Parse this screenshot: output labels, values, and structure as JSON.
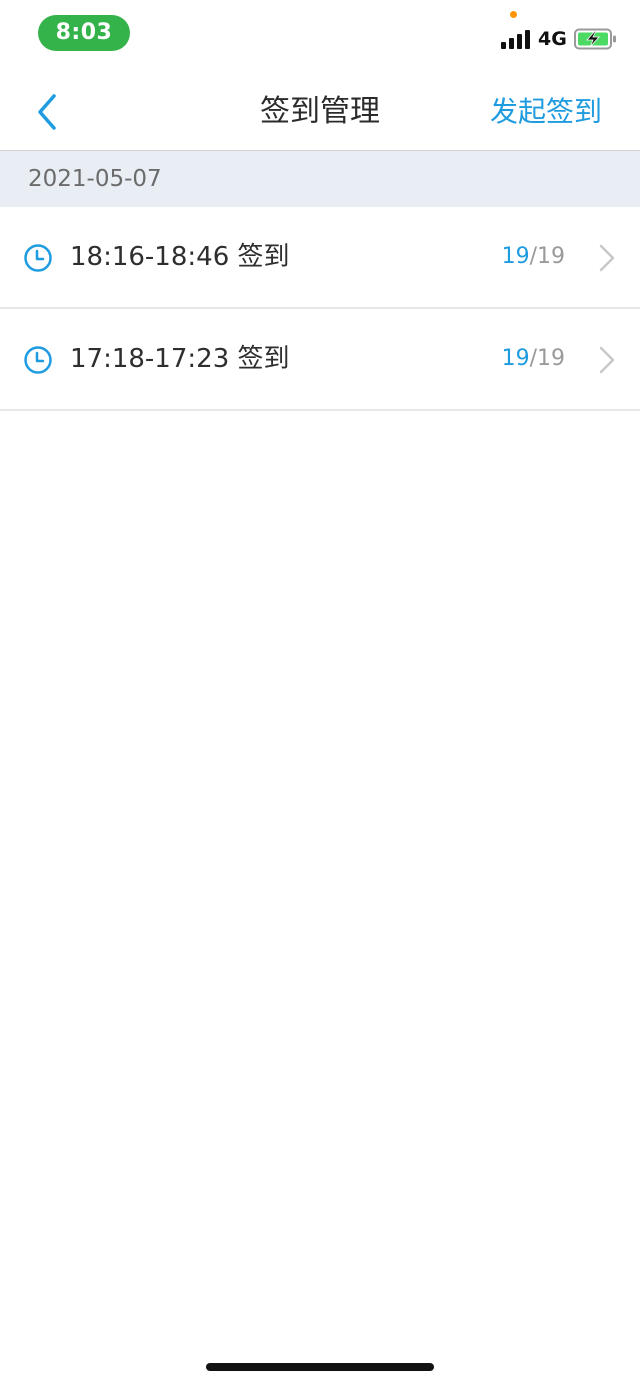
{
  "status_bar": {
    "time": "8:03",
    "network": "4G",
    "icons": [
      "signal-icon",
      "battery-charging-icon"
    ],
    "colors": {
      "time_pill": "#34b34a",
      "privacy_dot": "#ff9500",
      "battery_fill": "#4cd964"
    }
  },
  "nav": {
    "back_icon": "chevron-left-icon",
    "title": "签到管理",
    "action_label": "发起签到"
  },
  "section": {
    "date": "2021-05-07"
  },
  "checkins": [
    {
      "time_range": "18:16-18:46 签到",
      "signed": "19",
      "total": "/19"
    },
    {
      "time_range": "17:18-17:23 签到",
      "signed": "19",
      "total": "/19"
    }
  ],
  "theme": {
    "accent": "#1f9ce0",
    "section_bg": "#e9eef4",
    "text_primary": "#2e2e2e",
    "text_secondary": "#9a9a9a"
  }
}
